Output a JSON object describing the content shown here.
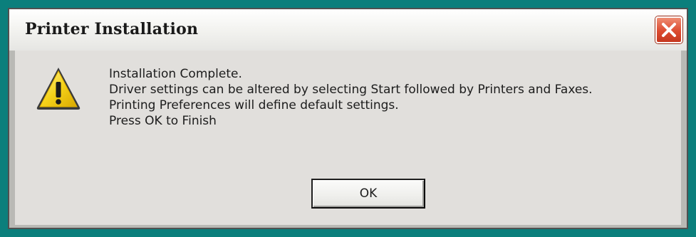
{
  "window": {
    "title": "Printer Installation",
    "close_icon": "close-x-icon"
  },
  "icon": {
    "name": "warning-triangle-icon",
    "fill": "#f5d21a",
    "outline": "#3a3a3a"
  },
  "message": {
    "lines": [
      "Installation Complete.",
      "Driver settings can be altered by selecting Start followed by Printers and Faxes.",
      "Printing Preferences will define default settings.",
      "Press OK to Finish"
    ]
  },
  "buttons": {
    "ok_label": "OK"
  },
  "colors": {
    "desktop": "#0b7f7c",
    "close_button": "#d9482d"
  }
}
